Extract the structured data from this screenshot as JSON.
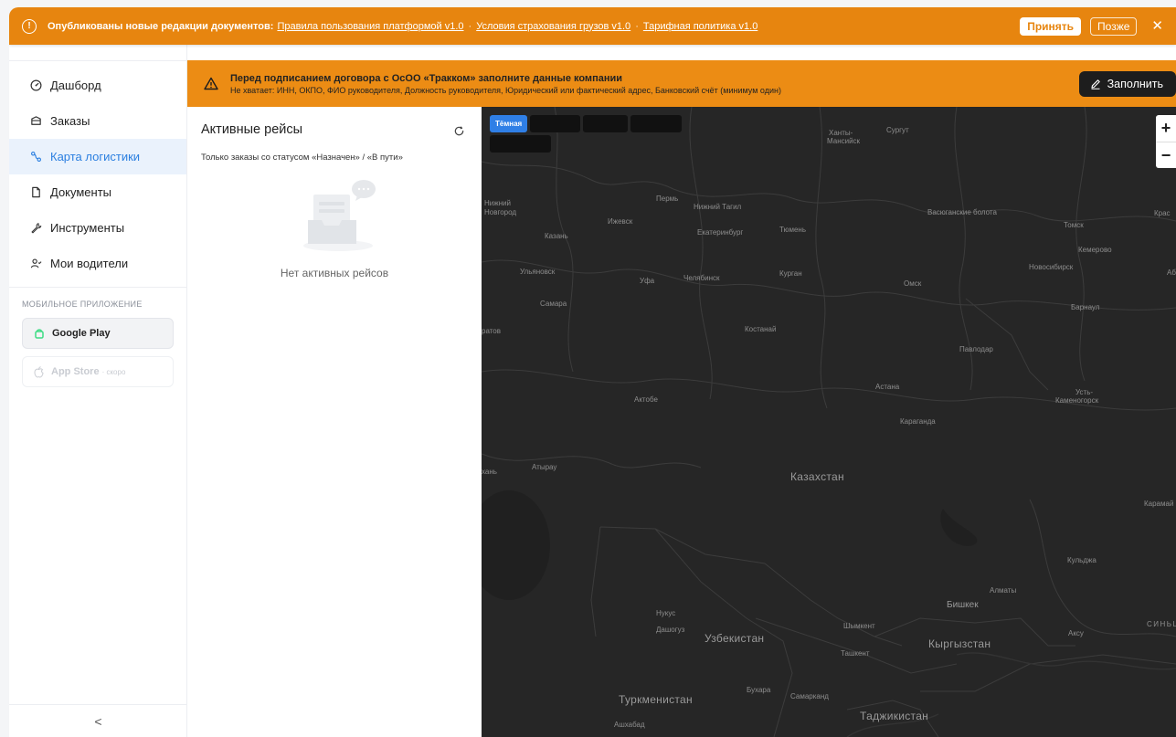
{
  "notification": {
    "lead": "Опубликованы новые редакции документов:",
    "links": [
      "Правила пользования платформой v1.0",
      "Условия страхования грузов v1.0",
      "Тарифная политика v1.0"
    ],
    "separator": "·",
    "accept_label": "Принять",
    "later_label": "Позже",
    "close_glyph": "✕",
    "info_glyph": "!"
  },
  "sidebar": {
    "items": [
      {
        "label": "Дашборд",
        "icon": "gauge-icon"
      },
      {
        "label": "Заказы",
        "icon": "box-icon"
      },
      {
        "label": "Карта логистики",
        "icon": "route-icon"
      },
      {
        "label": "Документы",
        "icon": "document-icon"
      },
      {
        "label": "Инструменты",
        "icon": "wrench-icon"
      },
      {
        "label": "Мои водители",
        "icon": "drivers-icon"
      }
    ],
    "active_index": 2,
    "mobile_label": "МОБИЛЬНОЕ ПРИЛОЖЕНИЕ",
    "google_play": "Google Play",
    "app_store": "App Store",
    "app_store_soon": "· скоро",
    "collapse_glyph": "<"
  },
  "warning": {
    "title": "Перед подписанием договора с ОсОО «Тракком» заполните данные компании",
    "details": "Не хватает: ИНН, ОКПО, ФИО руководителя, Должность руководителя, Юридический или фактический адрес, Банковский счёт (минимум один)",
    "fill_label": "Заполнить"
  },
  "trips": {
    "title": "Активные рейсы",
    "subtitle": "Только заказы со статусом «Назначен» / «В пути»",
    "empty_text": "Нет активных рейсов"
  },
  "map": {
    "styles": [
      "Тёмная",
      "",
      "",
      "",
      ""
    ],
    "active_style": 0,
    "zoom_in": "+",
    "zoom_out": "−",
    "labels": {
      "khanty": "Ханты-",
      "mansiysk": "Мансийск",
      "surgut": "Сургут",
      "perm": "Пермь",
      "nizhny": "Нижний",
      "novgorod": "Новгород",
      "ntagil": "Нижний Тагил",
      "izhevsk": "Ижевск",
      "kazan": "Казань",
      "ekb": "Екатеринбург",
      "tyumen": "Тюмень",
      "vasyugan": "Васюганские болота",
      "tomsk": "Томск",
      "kras": "Крас",
      "kemerovo": "Кемерово",
      "ulyanovsk": "Ульяновск",
      "ufa": "Уфа",
      "chel": "Челябинск",
      "kurgan": "Курган",
      "omsk": "Омск",
      "novosib": "Новосибирск",
      "ab": "Аб",
      "samara": "Самара",
      "barnaul": "Барнаул",
      "ratov": "ратов",
      "kostanay": "Костанай",
      "pavlodar": "Павлодар",
      "astana": "Астана",
      "ust1": "Усть-",
      "ust2": "Каменогорск",
      "aktobe": "Актобе",
      "karaganda": "Караганда",
      "khan": "хань",
      "atyrau": "Атырау",
      "kz": "Казахстан",
      "karamay": "Карамай",
      "kuldzha": "Кульджа",
      "almaty": "Алматы",
      "bishkek": "Бишкек",
      "nukus": "Нукус",
      "dashoguz": "Дашогуз",
      "uz": "Узбекистан",
      "shymkent": "Шымкент",
      "kg": "Кыргызстан",
      "aksu": "Аксу",
      "sintsz": "СИНЬЦЗ",
      "tashkent": "Ташкент",
      "bukhara": "Бухара",
      "samarkand": "Самарканд",
      "tm": "Туркменистан",
      "tj": "Таджикистан",
      "ashgabat": "Ашхабад"
    }
  }
}
